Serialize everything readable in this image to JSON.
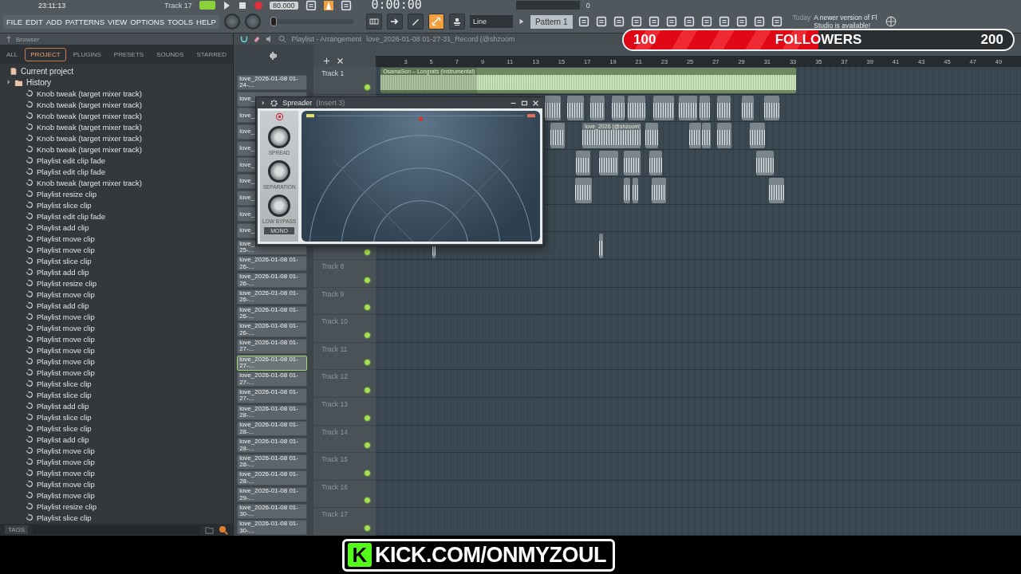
{
  "toolbar": {
    "clock": "23:11:13",
    "hint": "Track 17",
    "tempo": "80.000",
    "song_time": "0:00:00",
    "counter": "0",
    "song_mode": {
      "on": true
    },
    "menu": [
      "FILE",
      "EDIT",
      "ADD",
      "PATTERNS",
      "VIEW",
      "OPTIONS",
      "TOOLS",
      "HELP"
    ],
    "pitch": {
      "level": 0
    },
    "tools": [
      {
        "kind": "keyboard",
        "on": false
      },
      {
        "kind": "arrow",
        "on": false
      },
      {
        "kind": "pencil",
        "on": false
      },
      {
        "kind": "link",
        "on": true
      },
      {
        "kind": "stamp",
        "on": false
      }
    ],
    "snap": "Line",
    "pattern": "Pattern 1",
    "news": {
      "day": "Today",
      "text": "A newer version of Fl Studio is available!"
    }
  },
  "browser": {
    "title": "Browser",
    "tabs": [
      {
        "label": "ALL",
        "selected": false
      },
      {
        "label": "PROJECT",
        "selected": true
      },
      {
        "label": "PLUGINS",
        "selected": false
      },
      {
        "label": "PRESETS",
        "selected": false
      },
      {
        "label": "SOUNDS",
        "selected": false
      },
      {
        "label": "STARRED",
        "selected": false
      }
    ],
    "tree": [
      {
        "label": "Current project",
        "children": [
          {
            "label": "History",
            "children": [
              {
                "label": "Knob tweak (target mixer track)"
              },
              {
                "label": "Knob tweak (target mixer track)"
              },
              {
                "label": "Knob tweak (target mixer track)"
              },
              {
                "label": "Knob tweak (target mixer track)"
              },
              {
                "label": "Knob tweak (target mixer track)"
              },
              {
                "label": "Knob tweak (target mixer track)"
              },
              {
                "label": "Playlist edit clip fade"
              },
              {
                "label": "Playlist edit clip fade"
              },
              {
                "label": "Knob tweak (target mixer track)"
              },
              {
                "label": "Playlist resize clip"
              },
              {
                "label": "Playlist slice clip"
              },
              {
                "label": "Playlist edit clip fade"
              },
              {
                "label": "Playlist add clip"
              },
              {
                "label": "Playlist move clip"
              },
              {
                "label": "Playlist move clip"
              },
              {
                "label": "Playlist slice clip"
              },
              {
                "label": "Playlist add clip"
              },
              {
                "label": "Playlist resize clip"
              },
              {
                "label": "Playlist move clip"
              },
              {
                "label": "Playlist add clip"
              },
              {
                "label": "Playlist move clip"
              },
              {
                "label": "Playlist move clip"
              },
              {
                "label": "Playlist move clip"
              },
              {
                "label": "Playlist move clip"
              },
              {
                "label": "Playlist move clip"
              },
              {
                "label": "Playlist move clip"
              },
              {
                "label": "Playlist slice clip"
              },
              {
                "label": "Playlist slice clip"
              },
              {
                "label": "Playlist add clip"
              },
              {
                "label": "Playlist slice clip"
              },
              {
                "label": "Playlist slice clip"
              },
              {
                "label": "Playlist add clip"
              },
              {
                "label": "Playlist move clip"
              },
              {
                "label": "Playlist move clip"
              },
              {
                "label": "Playlist move clip"
              },
              {
                "label": "Playlist move clip"
              },
              {
                "label": "Playlist move clip"
              },
              {
                "label": "Playlist resize clip"
              },
              {
                "label": "Playlist slice clip"
              }
            ]
          }
        ]
      }
    ],
    "tags_label": "TAGS"
  },
  "playlist": {
    "title": "Playlist - Arrangement",
    "file": "love_2026-01-08 01-27-31_Record (@shzoom",
    "ruler": [
      "3",
      "5",
      "7",
      "9",
      "11",
      "13",
      "15",
      "17",
      "19",
      "21",
      "23",
      "25",
      "27",
      "29",
      "31",
      "33",
      "35",
      "37",
      "39",
      "41",
      "43",
      "45",
      "47",
      "49"
    ],
    "clips": [
      {
        "label": "love_2026-01-08 01-24-...",
        "selected": false
      },
      {
        "label": "love_",
        "selected": false
      },
      {
        "label": "love_",
        "selected": false
      },
      {
        "label": "love_",
        "selected": false
      },
      {
        "label": "love_",
        "selected": false
      },
      {
        "label": "love_",
        "selected": false
      },
      {
        "label": "love_",
        "selected": false
      },
      {
        "label": "love_",
        "selected": false
      },
      {
        "label": "love_",
        "selected": false
      },
      {
        "label": "love_",
        "selected": false
      },
      {
        "label": "love_2026-01-08 01-25-...",
        "selected": false
      },
      {
        "label": "love_2026-01-08 01-26-...",
        "selected": false
      },
      {
        "label": "love_2026-01-08 01-26-...",
        "selected": false
      },
      {
        "label": "love_2026-01-08 01-26-...",
        "selected": false
      },
      {
        "label": "love_2026-01-08 01-26-...",
        "selected": false
      },
      {
        "label": "love_2026-01-08 01-26-...",
        "selected": false
      },
      {
        "label": "love_2026-01-08 01-27-...",
        "selected": false
      },
      {
        "label": "love_2026-01-08 01-27-...",
        "selected": true
      },
      {
        "label": "love_2026-01-08 01-27-...",
        "selected": false
      },
      {
        "label": "love_2026-01-08 01-27-...",
        "selected": false
      },
      {
        "label": "love_2026-01-08 01-28-...",
        "selected": false
      },
      {
        "label": "love_2026-01-08 01-28-...",
        "selected": false
      },
      {
        "label": "love_2026-01-08 01-28-...",
        "selected": false
      },
      {
        "label": "love_2026-01-08 01-28-...",
        "selected": false
      },
      {
        "label": "love_2026-01-08 01-28-...",
        "selected": false
      },
      {
        "label": "love_2026-01-08 01-29-...",
        "selected": false
      },
      {
        "label": "love_2026-01-08 01-30-...",
        "selected": false
      },
      {
        "label": "love_2026-01-08 01-30-...",
        "selected": false
      }
    ],
    "tracks": [
      {
        "label": "Track 1"
      },
      {
        "label": "Track 8"
      },
      {
        "label": "Track 9"
      },
      {
        "label": "Track 10"
      },
      {
        "label": "Track 11"
      },
      {
        "label": "Track 12"
      },
      {
        "label": "Track 13"
      },
      {
        "label": "Track 14"
      },
      {
        "label": "Track 15"
      },
      {
        "label": "Track 16"
      },
      {
        "label": "Track 17"
      }
    ],
    "audio_clips": [
      {
        "label": "OsamaSon – Longrats (Instrumental)"
      },
      {
        "label": "love_2026 (@shzoom)"
      }
    ]
  },
  "plugin": {
    "name": "Spreader",
    "slot": "(Insert 3)",
    "knobs": [
      "SPREAD",
      "SEPARATION",
      "LOW BYPASS"
    ],
    "mono": "MONO"
  },
  "followers": {
    "start": "100",
    "label": "FOLLOWERS",
    "goal": "200",
    "level": 0.5
  },
  "banner": {
    "logo": "K",
    "url": "KICK.COM/ONMYZOUL"
  }
}
